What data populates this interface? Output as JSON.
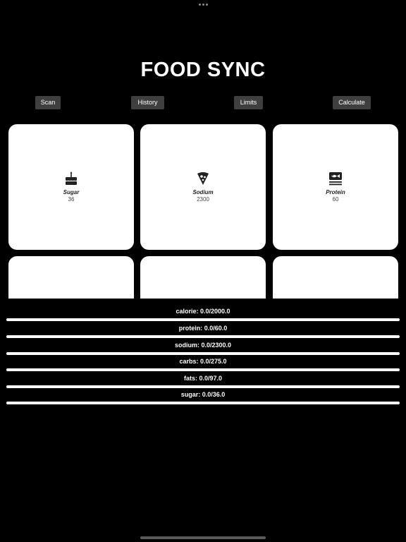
{
  "app": {
    "title": "FOOD SYNC"
  },
  "nav": [
    {
      "label": "Scan"
    },
    {
      "label": "History"
    },
    {
      "label": "Limits"
    },
    {
      "label": "Calculate"
    }
  ],
  "cards": [
    {
      "icon": "cake-icon",
      "label": "Sugar",
      "value": "36"
    },
    {
      "icon": "pizza-slice-icon",
      "label": "Sodium",
      "value": "2300"
    },
    {
      "icon": "fish-icon",
      "label": "Protein",
      "value": "60"
    },
    {
      "icon": "",
      "label": "",
      "value": ""
    },
    {
      "icon": "",
      "label": "",
      "value": ""
    },
    {
      "icon": "",
      "label": "",
      "value": ""
    }
  ],
  "progress": [
    {
      "label": "calorie: 0.0/2000.0",
      "current": 0.0,
      "max": 2000.0
    },
    {
      "label": "protein: 0.0/60.0",
      "current": 0.0,
      "max": 60.0
    },
    {
      "label": "sodium: 0.0/2300.0",
      "current": 0.0,
      "max": 2300.0
    },
    {
      "label": "carbs: 0.0/275.0",
      "current": 0.0,
      "max": 275.0
    },
    {
      "label": "fats: 0.0/97.0",
      "current": 0.0,
      "max": 97.0
    },
    {
      "label": "sugar: 0.0/36.0",
      "current": 0.0,
      "max": 36.0
    }
  ],
  "colors": {
    "background": "#000000",
    "card": "#ffffff",
    "button": "#3f3f3f",
    "track": "#ffffff",
    "fill": "#1f6fe0"
  }
}
